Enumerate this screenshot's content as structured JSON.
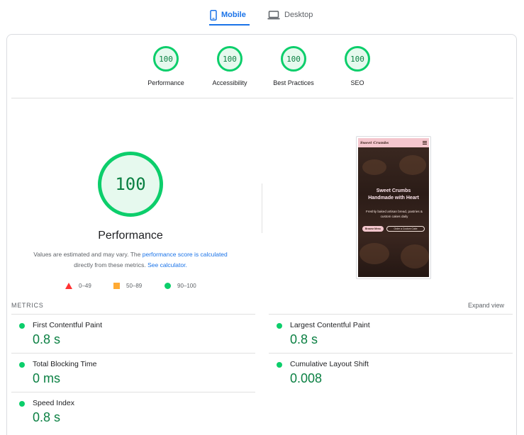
{
  "tabs": {
    "mobile": "Mobile",
    "desktop": "Desktop"
  },
  "categories": [
    {
      "score": "100",
      "label": "Performance"
    },
    {
      "score": "100",
      "label": "Accessibility"
    },
    {
      "score": "100",
      "label": "Best Practices"
    },
    {
      "score": "100",
      "label": "SEO"
    }
  ],
  "main": {
    "score": "100",
    "title": "Performance",
    "note_prefix": "Values are estimated and may vary. The ",
    "note_link": "performance score is calculated",
    "note_middle": " directly from these metrics. ",
    "note_link2": "See calculator.",
    "legend": {
      "fail": "0–49",
      "average": "50–89",
      "pass": "90–100"
    }
  },
  "screenshot": {
    "brand": "Sweet Crumbs",
    "headline_1": "Sweet Crumbs",
    "headline_2": "Handmade with Heart",
    "subtext": "Freshly baked artisan bread, pastries & custom cakes daily",
    "button_1": "Browse Menu",
    "button_2": "Order a Custom Cake"
  },
  "metrics": {
    "heading": "METRICS",
    "expand": "Expand view",
    "fcp": {
      "name": "First Contentful Paint",
      "value": "0.8 s"
    },
    "lcp": {
      "name": "Largest Contentful Paint",
      "value": "0.8 s"
    },
    "tbt": {
      "name": "Total Blocking Time",
      "value": "0 ms"
    },
    "cls": {
      "name": "Cumulative Layout Shift",
      "value": "0.008"
    },
    "si": {
      "name": "Speed Index",
      "value": "0.8 s"
    }
  },
  "colors": {
    "pass": "#0cce6b",
    "pass_text": "#0b8043",
    "average": "#ffaa33",
    "fail": "#ff3333",
    "accent": "#1a73e8"
  },
  "icons": {
    "mobile": "smartphone-icon",
    "desktop": "laptop-icon"
  }
}
